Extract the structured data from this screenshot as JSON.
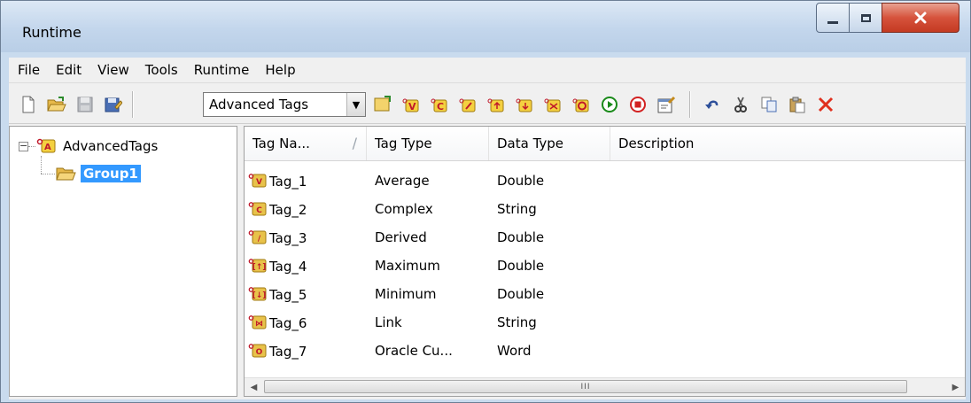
{
  "window": {
    "title": "Runtime",
    "controls": {
      "minimize": "minimize",
      "maximize": "maximize",
      "close": "close"
    }
  },
  "menubar": {
    "items": [
      {
        "label": "File"
      },
      {
        "label": "Edit"
      },
      {
        "label": "View"
      },
      {
        "label": "Tools"
      },
      {
        "label": "Runtime"
      },
      {
        "label": "Help"
      }
    ]
  },
  "toolbar": {
    "tag_type_selected": "Advanced Tags"
  },
  "tree": {
    "root": {
      "label": "AdvancedTags",
      "expander": "−"
    },
    "child": {
      "label": "Group1"
    }
  },
  "listview": {
    "columns": [
      "Tag Na...",
      "Tag Type",
      "Data Type",
      "Description"
    ],
    "sort_glyph": "/",
    "rows": [
      {
        "name": "Tag_1",
        "tag_type": "Average",
        "data_type": "Double",
        "description": "",
        "icon_text": "V"
      },
      {
        "name": "Tag_2",
        "tag_type": "Complex",
        "data_type": "String",
        "description": "",
        "icon_text": "C"
      },
      {
        "name": "Tag_3",
        "tag_type": "Derived",
        "data_type": "Double",
        "description": "",
        "icon_text": "/"
      },
      {
        "name": "Tag_4",
        "tag_type": "Maximum",
        "data_type": "Double",
        "description": "",
        "icon_text": "[↑]"
      },
      {
        "name": "Tag_5",
        "tag_type": "Minimum",
        "data_type": "Double",
        "description": "",
        "icon_text": "[↓]"
      },
      {
        "name": "Tag_6",
        "tag_type": "Link",
        "data_type": "String",
        "description": "",
        "icon_text": "⋈"
      },
      {
        "name": "Tag_7",
        "tag_type": "Oracle Cu...",
        "data_type": "Word",
        "description": "",
        "icon_text": "O"
      }
    ],
    "scroll_thumb_grip": "III"
  },
  "colors": {
    "selection": "#3399ff",
    "close_button": "#c43a22",
    "tag_icon_bg": "#e8c24a",
    "tag_icon_letter": "#c0182a"
  }
}
